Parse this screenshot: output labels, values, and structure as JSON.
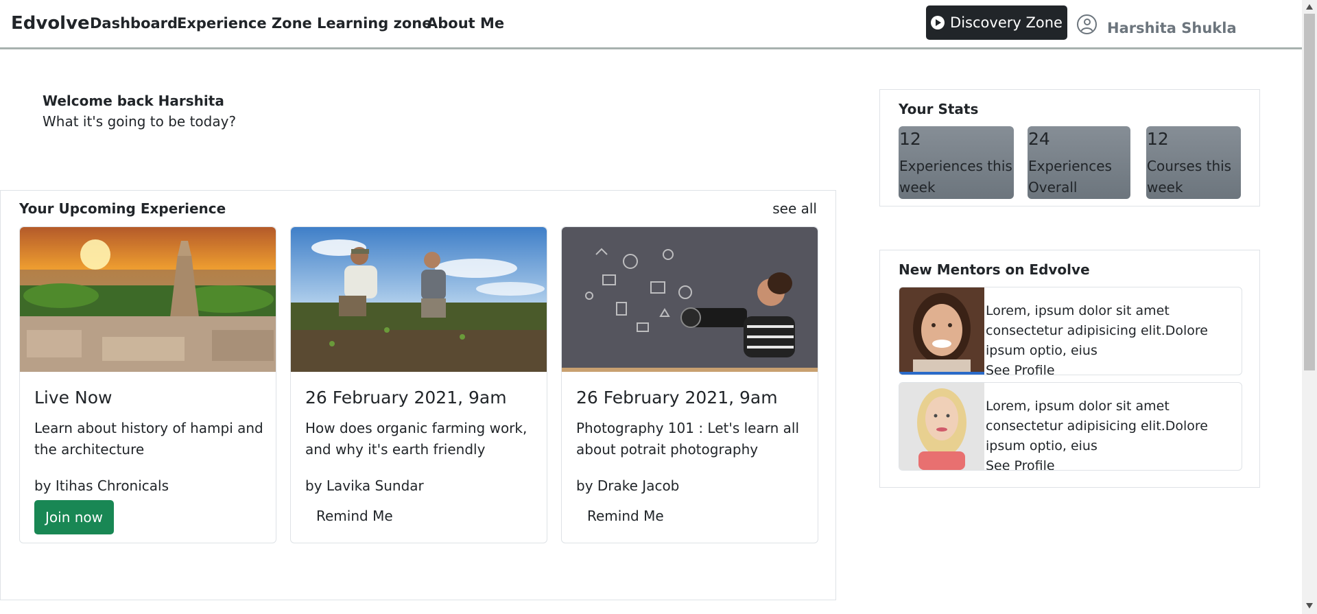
{
  "navbar": {
    "brand": "Edvolve",
    "links": [
      "Dashboard",
      "Experience Zone",
      "Learning zone",
      "About Me"
    ],
    "discovery_button": "Discovery Zone",
    "user_name": "Harshita Shukla"
  },
  "welcome": {
    "title": "Welcome back Harshita",
    "subtitle": "What it's going to be today?"
  },
  "upcoming": {
    "title": "Your Upcoming Experience",
    "see_all": "see all",
    "cards": [
      {
        "heading": "Live Now",
        "description": "Learn about history of hampi and the architecture",
        "author": "by Itihas Chronicals",
        "action": "Join now",
        "image": "hampi-temple-photo"
      },
      {
        "heading": "26 February 2021, 9am",
        "description": "How does organic farming work, and why it's earth friendly",
        "author": "by Lavika Sundar",
        "action": "Remind Me",
        "image": "farmers-field-photo"
      },
      {
        "heading": "26 February 2021, 9am",
        "description": "Photography 101 : Let's learn all about potrait photography",
        "author": "by Drake Jacob",
        "action": "Remind Me",
        "image": "photographer-camera-photo"
      }
    ]
  },
  "stats": {
    "title": "Your Stats",
    "items": [
      {
        "value": "12",
        "label": "Experiences this week"
      },
      {
        "value": "24",
        "label": "Experiences Overall"
      },
      {
        "value": "12",
        "label": "Courses this week"
      }
    ]
  },
  "mentors": {
    "title": "New Mentors on Edvolve",
    "items": [
      {
        "text": "Lorem, ipsum dolor sit amet consectetur adipisicing elit.Dolore ipsum optio, eius",
        "link": "See Profile",
        "image": "mentor-woman-brunette-photo"
      },
      {
        "text": "Lorem, ipsum dolor sit amet consectetur adipisicing elit.Dolore ipsum optio, eius",
        "link": "See Profile",
        "image": "mentor-woman-blonde-photo"
      }
    ]
  },
  "colors": {
    "dark": "#212529",
    "join_green": "#198754",
    "stat_gray": "#7a8289",
    "muted": "#6c757d"
  }
}
